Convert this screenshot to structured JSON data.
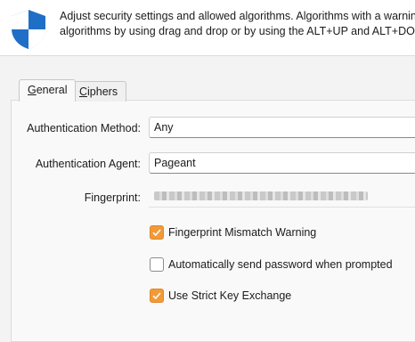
{
  "header": {
    "description_line1": "Adjust security settings and allowed algorithms. Algorithms with a warning s",
    "description_line2": "algorithms by using drag and drop or by using the ALT+UP and ALT+DOWN"
  },
  "tabs": [
    {
      "label_first": "G",
      "label_rest": "eneral",
      "active": true
    },
    {
      "label_first": "C",
      "label_rest": "iphers",
      "active": false
    }
  ],
  "form": {
    "auth_method": {
      "label": "Authentication Method:",
      "value": "Any"
    },
    "auth_agent": {
      "label": "Authentication Agent:",
      "value": "Pageant"
    },
    "fingerprint": {
      "label": "Fingerprint:"
    }
  },
  "options": [
    {
      "label": "Fingerprint Mismatch Warning",
      "checked": true
    },
    {
      "label": "Automatically send password when prompted",
      "checked": false
    },
    {
      "label": "Use Strict Key Exchange",
      "checked": true
    }
  ],
  "colors": {
    "accent": "#f19a37",
    "shield": "#1f6fc7"
  }
}
